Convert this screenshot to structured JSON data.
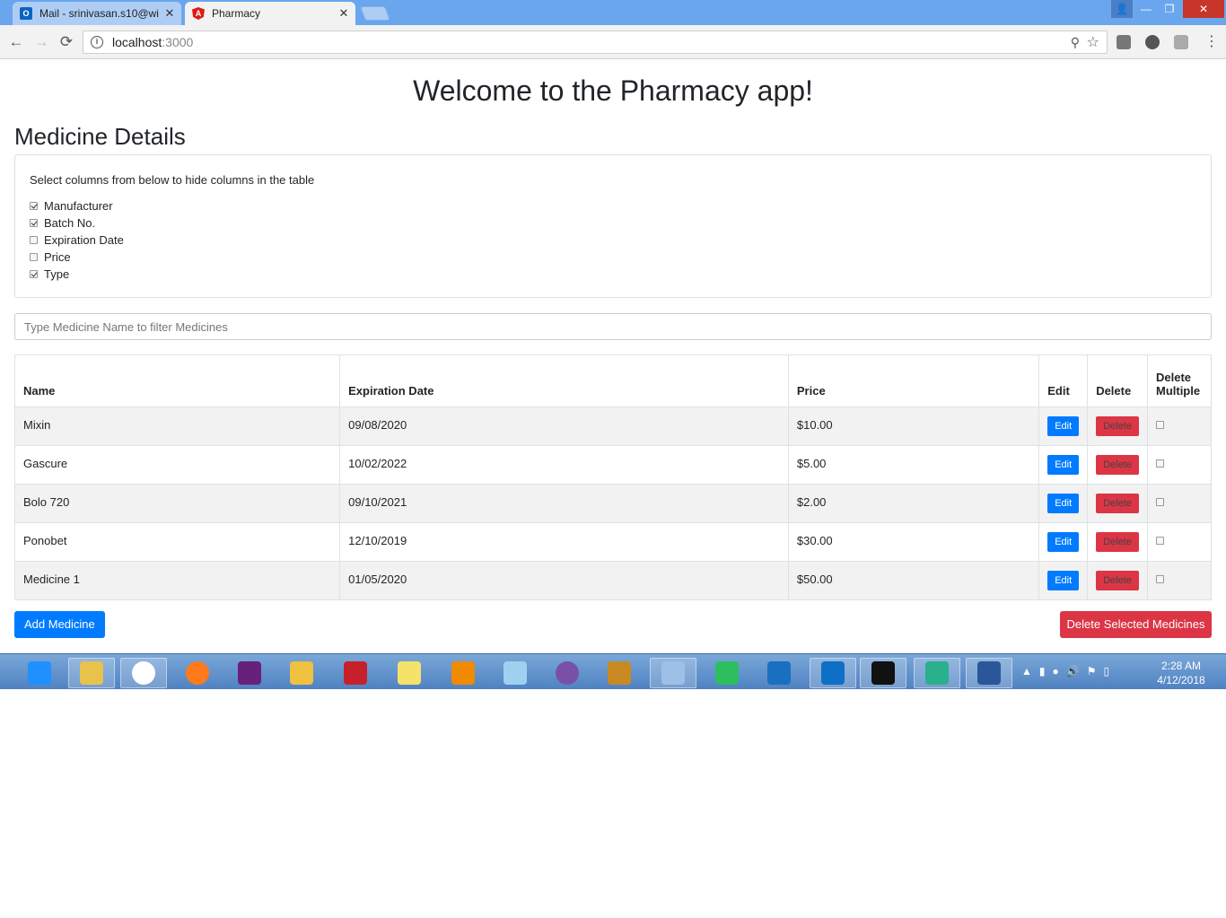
{
  "browser": {
    "tabs": [
      {
        "title": "Mail - srinivasan.s10@wi",
        "favicon": "outlook-icon",
        "active": false
      },
      {
        "title": "Pharmacy",
        "favicon": "angular-icon",
        "active": true
      }
    ],
    "address": {
      "host": "localhost",
      "port": ":3000"
    },
    "window_controls": {
      "close": "✕",
      "minimize": "—",
      "maximize": "❐"
    }
  },
  "page": {
    "title": "Welcome to the Pharmacy app!",
    "section_title": "Medicine Details",
    "column_picker": {
      "intro": "Select columns from below to hide columns in the table",
      "options": [
        {
          "label": "Manufacturer",
          "checked": true
        },
        {
          "label": "Batch No.",
          "checked": true
        },
        {
          "label": "Expiration Date",
          "checked": false
        },
        {
          "label": "Price",
          "checked": false
        },
        {
          "label": "Type",
          "checked": true
        }
      ]
    },
    "filter": {
      "placeholder": "Type Medicine Name to filter Medicines",
      "value": ""
    },
    "table": {
      "headers": {
        "name": "Name",
        "expiration": "Expiration Date",
        "price": "Price",
        "edit": "Edit",
        "delete": "Delete",
        "delete_multiple": "Delete Multiple"
      },
      "rows": [
        {
          "name": "Mixin",
          "expiration": "09/08/2020",
          "price": "$10.00",
          "edit": "Edit",
          "delete": "Delete",
          "selected": false
        },
        {
          "name": "Gascure",
          "expiration": "10/02/2022",
          "price": "$5.00",
          "edit": "Edit",
          "delete": "Delete",
          "selected": false
        },
        {
          "name": "Bolo 720",
          "expiration": "09/10/2021",
          "price": "$2.00",
          "edit": "Edit",
          "delete": "Delete",
          "selected": false
        },
        {
          "name": "Ponobet",
          "expiration": "12/10/2019",
          "price": "$30.00",
          "edit": "Edit",
          "delete": "Delete",
          "selected": false
        },
        {
          "name": "Medicine 1",
          "expiration": "01/05/2020",
          "price": "$50.00",
          "edit": "Edit",
          "delete": "Delete",
          "selected": false
        }
      ]
    },
    "buttons": {
      "add": "Add Medicine",
      "delete_selected": "Delete Selected Medicines"
    }
  },
  "taskbar": {
    "apps": [
      "internet-explorer-icon",
      "file-explorer-icon",
      "chrome-icon",
      "firefox-icon",
      "visual-studio-icon",
      "snipping-tool-icon",
      "downloader-icon",
      "sticky-notes-icon",
      "vlc-icon",
      "notepad-icon",
      "torrent-icon",
      "word-old-icon",
      "paint-icon",
      "evernote-icon",
      "vpn-icon",
      "vscode-icon",
      "terminal-icon",
      "atom-icon",
      "word-icon"
    ],
    "clock": {
      "time": "2:28 AM",
      "date": "4/12/2018"
    }
  },
  "colors": {
    "primary": "#007bff",
    "danger": "#dc3545",
    "tabstrip": "#6aa6ee",
    "taskbar": "#4f82c2"
  }
}
